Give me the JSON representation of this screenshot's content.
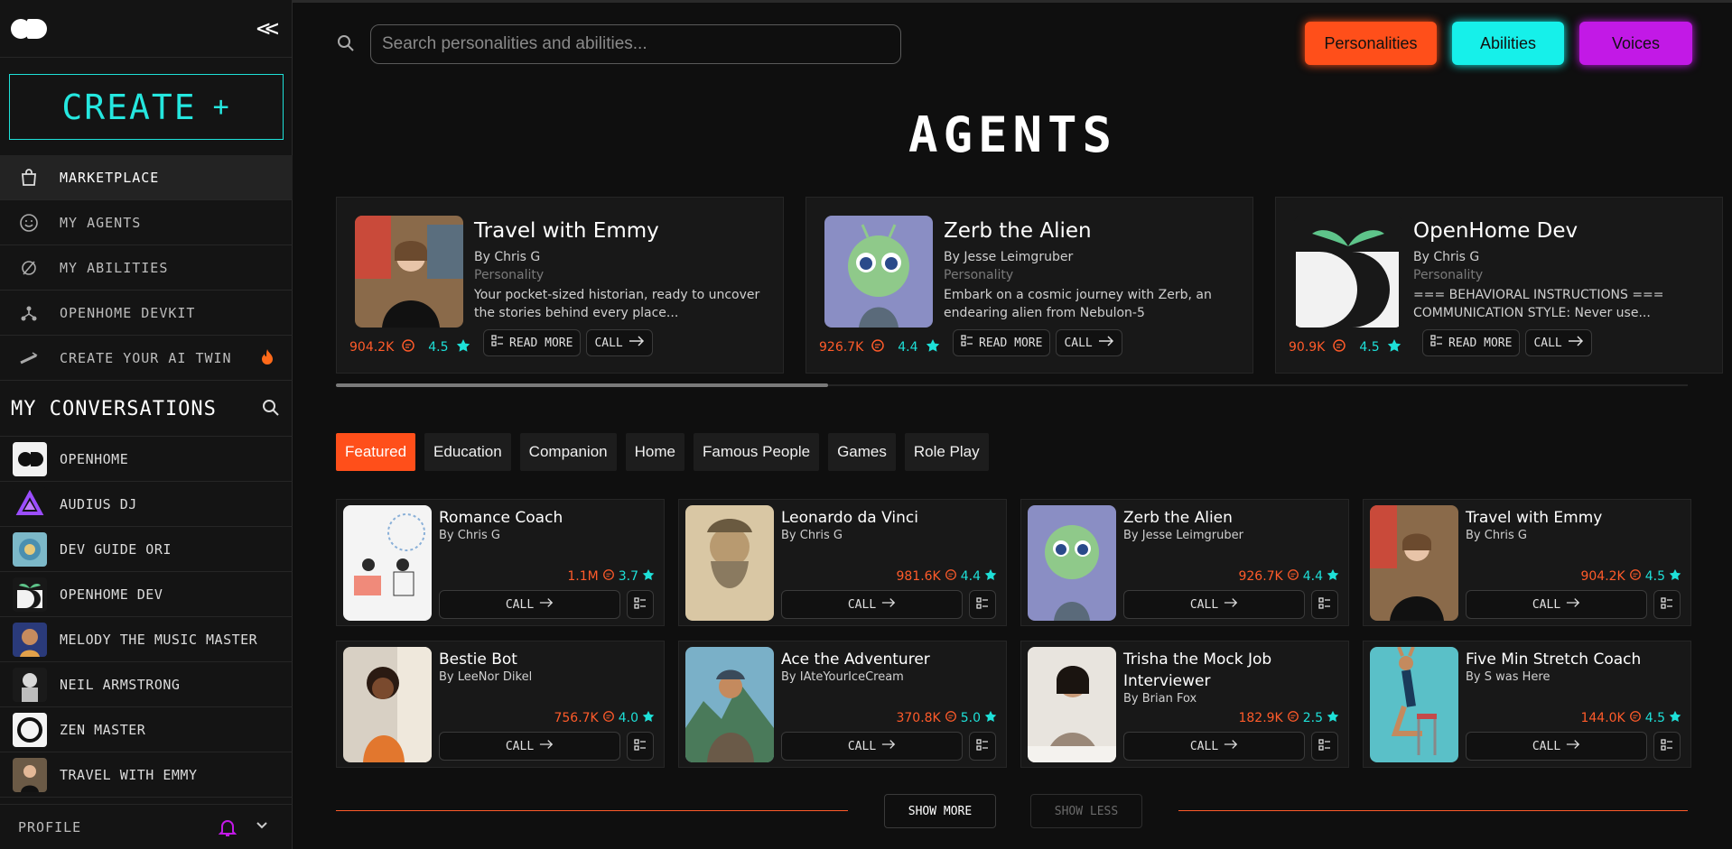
{
  "sidebar": {
    "create_label": "CREATE",
    "nav": [
      {
        "label": "MARKETPLACE",
        "icon": "bag-icon"
      },
      {
        "label": "MY AGENTS",
        "icon": "smiley-icon"
      },
      {
        "label": "MY ABILITIES",
        "icon": "ability-icon"
      },
      {
        "label": "OPENHOME DEVKIT",
        "icon": "devkit-icon"
      },
      {
        "label": "CREATE YOUR AI TWIN",
        "icon": "twin-icon"
      }
    ],
    "conversations_title": "MY CONVERSATIONS",
    "conversations": [
      {
        "label": "OPENHOME"
      },
      {
        "label": "AUDIUS DJ"
      },
      {
        "label": "DEV GUIDE ORI"
      },
      {
        "label": "OPENHOME DEV"
      },
      {
        "label": "MELODY THE MUSIC MASTER"
      },
      {
        "label": "NEIL ARMSTRONG"
      },
      {
        "label": "ZEN MASTER"
      },
      {
        "label": "TRAVEL WITH EMMY"
      }
    ],
    "profile_label": "PROFILE"
  },
  "header": {
    "search_placeholder": "Search personalities and abilities...",
    "pills": [
      "Personalities",
      "Abilities",
      "Voices"
    ]
  },
  "page_title": "AGENTS",
  "featured_hero": [
    {
      "name": "Travel with Emmy",
      "by": "By Chris G",
      "type": "Personality",
      "desc": "Your pocket-sized historian, ready to uncover the stories behind every place...",
      "count": "904.2K",
      "rating": "4.5"
    },
    {
      "name": "Zerb the Alien",
      "by": "By Jesse Leimgruber",
      "type": "Personality",
      "desc": "Embark on a cosmic journey with Zerb, an endearing alien from Nebulon-5",
      "count": "926.7K",
      "rating": "4.4"
    },
    {
      "name": "OpenHome Dev",
      "by": "By Chris G",
      "type": "Personality",
      "desc": "=== BEHAVIORAL INSTRUCTIONS === COMMUNICATION STYLE: Never use...",
      "count": "90.9K",
      "rating": "4.5"
    }
  ],
  "hero_buttons": {
    "read_more": "READ MORE",
    "call": "CALL"
  },
  "categories": [
    "Featured",
    "Education",
    "Companion",
    "Home",
    "Famous People",
    "Games",
    "Role Play"
  ],
  "cards": [
    {
      "name": "Romance Coach",
      "by": "By Chris G",
      "count": "1.1M",
      "rating": "3.7"
    },
    {
      "name": "Leonardo da Vinci",
      "by": "By Chris G",
      "count": "981.6K",
      "rating": "4.4"
    },
    {
      "name": "Zerb the Alien",
      "by": "By Jesse Leimgruber",
      "count": "926.7K",
      "rating": "4.4"
    },
    {
      "name": "Travel with Emmy",
      "by": "By Chris G",
      "count": "904.2K",
      "rating": "4.5"
    },
    {
      "name": "Bestie Bot",
      "by": "By LeeNor Dikel",
      "count": "756.7K",
      "rating": "4.0"
    },
    {
      "name": "Ace the Adventurer",
      "by": "By IAteYourIceCream",
      "count": "370.8K",
      "rating": "5.0"
    },
    {
      "name": "Trisha the Mock Job Interviewer",
      "by": "By Brian Fox",
      "count": "182.9K",
      "rating": "2.5"
    },
    {
      "name": "Five Min Stretch Coach",
      "by": "By S was Here",
      "count": "144.0K",
      "rating": "4.5"
    }
  ],
  "card_call_label": "CALL",
  "show_more": "SHOW MORE",
  "show_less": "SHOW LESS",
  "colors": {
    "accent_orange": "#ff4f1a",
    "accent_cyan": "#16f0ea",
    "accent_purple": "#c219e6"
  }
}
